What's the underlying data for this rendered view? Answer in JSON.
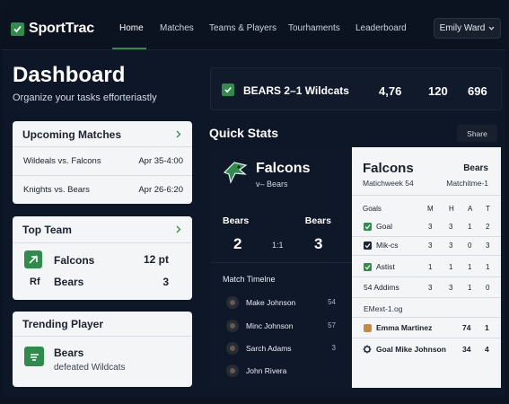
{
  "app": {
    "name": "SportTrac",
    "accent": "#2f8c4b"
  },
  "nav": {
    "items": [
      {
        "label": "Home",
        "active": true
      },
      {
        "label": "Matches"
      },
      {
        "label": "Teams & Players"
      },
      {
        "label": "Tourhaments"
      },
      {
        "label": "Leaderboard"
      }
    ],
    "user": "Emily Ward"
  },
  "page": {
    "title": "Dashboard",
    "subtitle": "Organize your tasks efforteriastly"
  },
  "upcoming": {
    "title": "Upcoming Matches",
    "matches": [
      {
        "teams": "Wildeals vs. Falcons",
        "date": "Apr 35-4:00"
      },
      {
        "teams": "Knights vs. Bears",
        "date": "Apr 26-6:20"
      }
    ]
  },
  "top_team": {
    "title": "Top Team",
    "rows": [
      {
        "badge": "",
        "name": "Falcons",
        "value": "12 pt"
      },
      {
        "badge": "Rf",
        "name": "Bears",
        "value": "3"
      }
    ]
  },
  "trending": {
    "title": "Trending Player",
    "name": "Bears",
    "sub": "defeated Wildcats"
  },
  "score_banner": {
    "label": "BEARS 2–1 Wildcats",
    "stats": [
      "4,76",
      "120",
      "696"
    ]
  },
  "quick_stats": {
    "title": "Quick Stats",
    "share": "Share"
  },
  "match_card": {
    "team": "Falcons",
    "vs": "v– Bears",
    "left_team": "Bears",
    "right_team": "Bears",
    "left_score": "2",
    "mid": "1:1",
    "right_score": "3",
    "timeline_title": "Match Timelne",
    "timeline": [
      {
        "name": "Make  Johnson",
        "num": "54"
      },
      {
        "name": "Minc  Johnson",
        "num": "57"
      },
      {
        "name": "Sarch Adams",
        "num": "3"
      },
      {
        "name": "John Rivera",
        "num": ""
      }
    ]
  },
  "stats_card": {
    "team": "Falcons",
    "opp": "Bears",
    "sub_left": "Matichweek 54",
    "sub_right": "Matchitme-1",
    "headers": [
      "Goals",
      "M",
      "H",
      "A",
      "T"
    ],
    "rows": [
      {
        "label": "Goal",
        "box": "green",
        "values": [
          "3",
          "3",
          "1",
          "2"
        ]
      },
      {
        "label": "Mik-cs",
        "box": "dark",
        "values": [
          "3",
          "3",
          "0",
          "3"
        ]
      },
      {
        "label": "Astist",
        "box": "green",
        "values": [
          "1",
          "1",
          "1",
          "1"
        ]
      },
      {
        "label": "54  Addims",
        "box": "",
        "values": [
          "3",
          "3",
          "1",
          "0"
        ]
      }
    ],
    "section": "EMext-1.og",
    "players": [
      {
        "icon": "square",
        "name": "Emma Martinez",
        "a": "74",
        "b": "1"
      },
      {
        "icon": "gear",
        "name": "Goal Mike Johnson",
        "a": "34",
        "b": "4"
      }
    ]
  }
}
